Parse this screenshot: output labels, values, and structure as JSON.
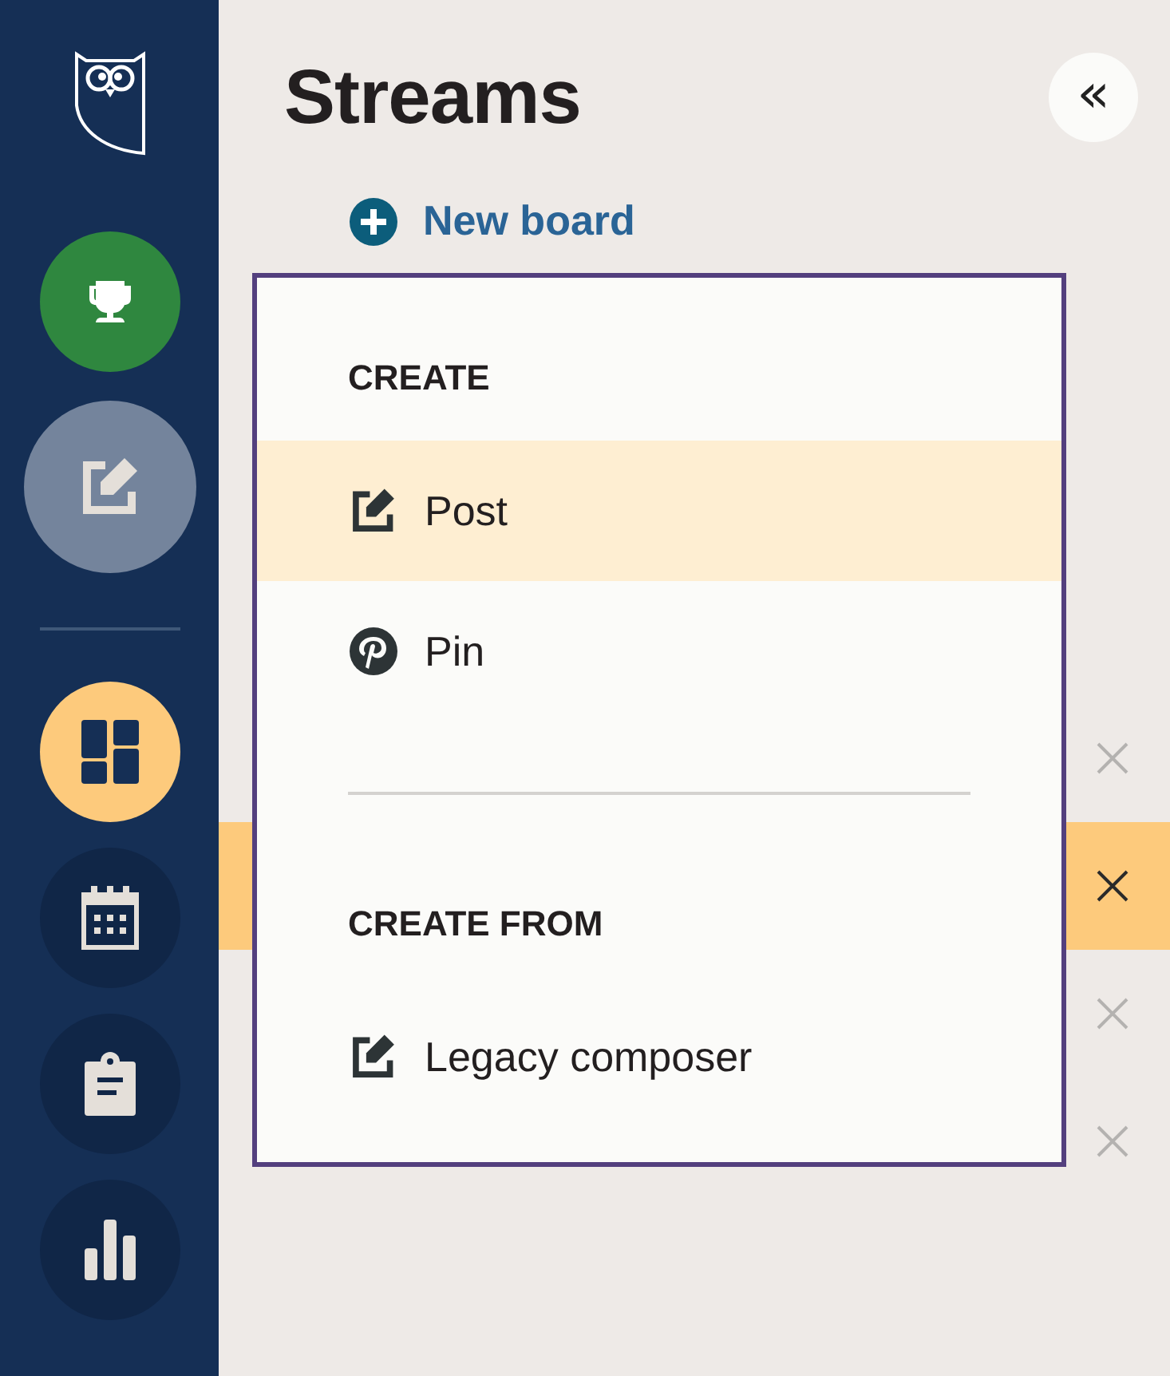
{
  "sidebar": {
    "actions": [
      {
        "kind": "trophy"
      },
      {
        "kind": "compose"
      }
    ],
    "nav": [
      {
        "kind": "dashboard",
        "selected": true
      },
      {
        "kind": "calendar",
        "selected": false
      },
      {
        "kind": "clipboard",
        "selected": false
      },
      {
        "kind": "chart",
        "selected": false
      }
    ]
  },
  "header": {
    "title": "Streams",
    "collapse": "«"
  },
  "new_board": {
    "label": "New board"
  },
  "boards": [
    {
      "selected": false
    },
    {
      "selected": true
    },
    {
      "selected": false
    },
    {
      "selected": false
    }
  ],
  "menu": {
    "sections": [
      {
        "heading": "CREATE",
        "items": [
          {
            "kind": "compose",
            "label": "Post",
            "selected": true
          },
          {
            "kind": "pin",
            "label": "Pin",
            "selected": false
          }
        ]
      },
      {
        "heading": "CREATE FROM",
        "items": [
          {
            "kind": "compose",
            "label": "Legacy composer",
            "selected": false
          }
        ]
      }
    ]
  }
}
